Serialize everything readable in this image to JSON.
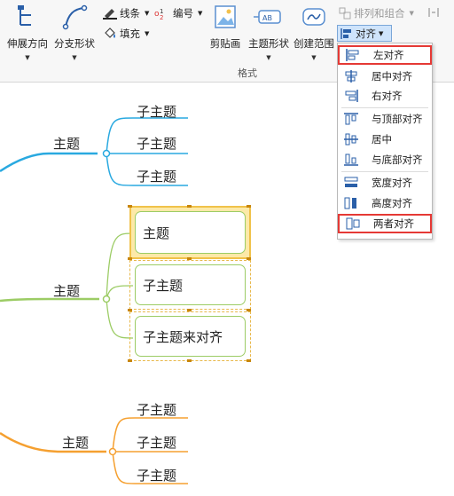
{
  "ribbon": {
    "grow_direction": "伸展方向",
    "branch_shape": "分支形状",
    "line_label": "线条",
    "fill_label": "填充",
    "number_label": "编号",
    "clip_art": "剪贴画",
    "topic_shape": "主题形状",
    "create_range": "创建范围",
    "arrange_combine": "排列和组合",
    "align": "对齐",
    "format_group": "格式"
  },
  "menu": {
    "items": [
      {
        "label": "左对齐",
        "icon": "align-left-icon",
        "highlighted": true
      },
      {
        "label": "居中对齐",
        "icon": "align-center-icon",
        "highlighted": false
      },
      {
        "label": "右对齐",
        "icon": "align-right-icon",
        "highlighted": false
      },
      {
        "label": "与顶部对齐",
        "icon": "align-top-icon",
        "highlighted": false
      },
      {
        "label": "居中",
        "icon": "align-middle-icon",
        "highlighted": false
      },
      {
        "label": "与底部对齐",
        "icon": "align-bottom-icon",
        "highlighted": false
      },
      {
        "label": "宽度对齐",
        "icon": "same-width-icon",
        "highlighted": false
      },
      {
        "label": "高度对齐",
        "icon": "same-height-icon",
        "highlighted": false
      },
      {
        "label": "两者对齐",
        "icon": "same-size-icon",
        "highlighted": true
      }
    ]
  },
  "mindmap": {
    "branch1": {
      "topic": "主题",
      "subtopics": [
        "子主题",
        "子主题",
        "子主题"
      ],
      "color": "#29a9e0"
    },
    "branch2": {
      "topic": "主题",
      "subtopics": [
        "主题",
        "子主题",
        "子主题来对齐"
      ],
      "color": "#9ccc65"
    },
    "branch3": {
      "topic": "主题",
      "subtopics": [
        "子主题",
        "子主题",
        "子主题"
      ],
      "color": "#f5a030"
    }
  },
  "colors": {
    "highlight": "#e53935",
    "selection": "#f0c24a",
    "button_active": "#cfe4fb"
  }
}
